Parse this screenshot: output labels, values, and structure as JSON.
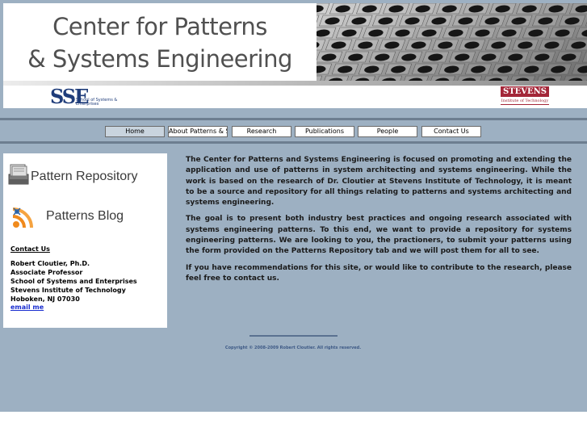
{
  "header": {
    "title_line1": "Center for Patterns",
    "title_line2": "& Systems Engineering"
  },
  "logos": {
    "sse_letters": "SSE",
    "sse_caption": "School of Systems & Enterprises",
    "stevens_word": "STEVENS",
    "stevens_sub": "Institute of Technology"
  },
  "nav": {
    "items": [
      {
        "label": "Home",
        "active": true
      },
      {
        "label": "About Patterns & SE"
      },
      {
        "label": "Research"
      },
      {
        "label": "Publications"
      },
      {
        "label": "People"
      },
      {
        "label": "Contact Us"
      }
    ]
  },
  "sidebar": {
    "repository_label": "Pattern Repository",
    "repository_icon": "repository-icon",
    "blog_label": "Patterns Blog",
    "blog_icon": "rss-feed-icon",
    "contact_heading": "Contact Us",
    "contact_lines": [
      "Robert Cloutier, Ph.D.",
      "Associate Professor",
      "School of Systems and Enterprises",
      "Stevens Institute of Technology",
      "Hoboken, NJ 07030"
    ],
    "email_label": "email me"
  },
  "main": {
    "paragraphs": [
      "The Center for Patterns and Systems Engineering is focused on promoting and extending the application and use of patterns in system architecting and systems engineering. While the work is based on the research of Dr. Cloutier at Stevens Institute of Technology, it is meant to be a source and repository for all things relating to patterns and systems architecting and systems engineering.",
      "The  goal is to present both industry best practices and ongoing research associated with systems engineering patterns. To this end, we want to provide a repository for systems engineering patterns. We are looking to you, the practioners, to submit your patterns using the form provided on the Patterns Repository tab and we will post them for all to see.",
      "If you have recommendations for this site, or would like to contribute to the research, please feel free to contact us."
    ]
  },
  "footer": {
    "copyright": "Copyright © 2008-2009 Robert Cloutier. All rights reserved."
  },
  "colors": {
    "page_background": "#9db0c2",
    "nav_bar": "#6d7e90",
    "link": "#1a2ed0",
    "stevens_red": "#a32638",
    "sse_blue": "#1f3d7a"
  }
}
